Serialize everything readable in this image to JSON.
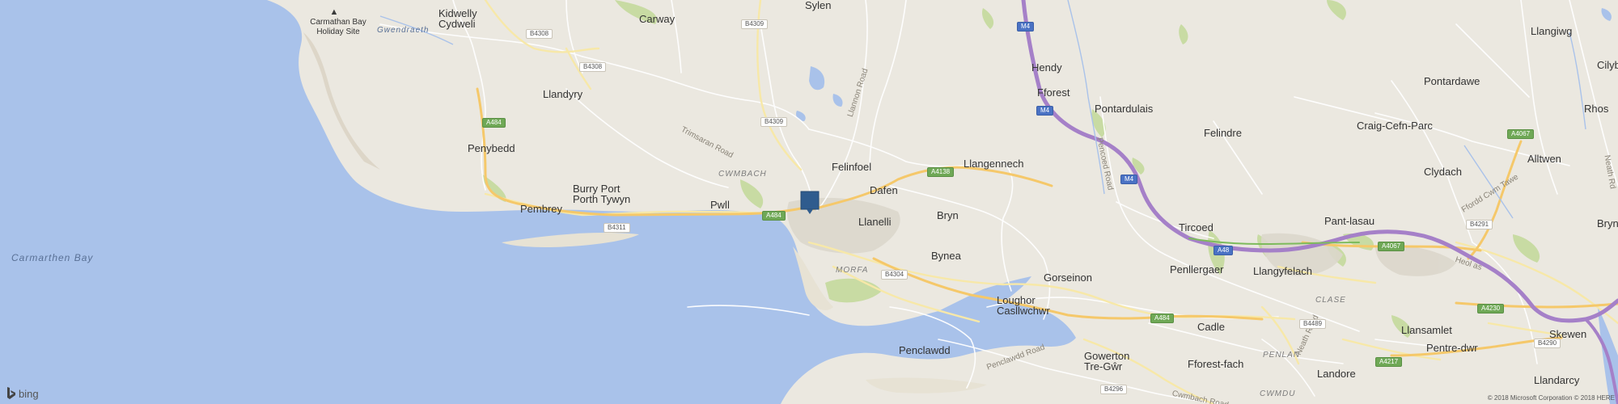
{
  "map": {
    "provider": "bing",
    "copyright": "© 2018 Microsoft Corporation © 2018 HERE",
    "water_labels": [
      "Carmarthen Bay",
      "Gwendraeth"
    ],
    "places": [
      "Carmathan Bay Holiday Site",
      "Kidwelly Cydweli",
      "Carway",
      "Sylen",
      "Llandyry",
      "Penybedd",
      "Burry Port Porth Tywyn",
      "Pembrey",
      "Pwll",
      "Felinfoel",
      "Dafen",
      "Llanelli",
      "Llangennech",
      "Hendy",
      "Fforest",
      "Pontardulais",
      "Bryn",
      "Bynea",
      "Gorseinon",
      "Loughor Casllwchwr",
      "Penclawdd",
      "Gowerton Tre-Gŵr",
      "Tircoed",
      "Penllergaer",
      "Felindre",
      "Cadle",
      "Fforest-fach",
      "Craig-Cefn-Parc",
      "Pontardawe",
      "Llangiwg",
      "Cilybe",
      "Rhos",
      "Alltwen",
      "Clydach",
      "Pant-lasau",
      "Llangyfelach",
      "Llansamlet",
      "Skewen",
      "Bryn-",
      "Pentre-dwr",
      "Llandarcy",
      "Landore"
    ],
    "districts": [
      "CWMBACH",
      "MORFA",
      "CLASE",
      "PENLAN",
      "CWMDU"
    ],
    "roads": [
      "Trimsaran Road",
      "Llannon Road",
      "Pencoed Road",
      "Penclawdd Road",
      "Cwmbach Road",
      "Neath Road",
      "Ffordd Cwm Tawe",
      "Heol as",
      "Neath Rd"
    ],
    "shields": [
      "B4308",
      "B4308",
      "B4309",
      "B4309",
      "A484",
      "B4311",
      "A484",
      "A4138",
      "B4304",
      "M4",
      "M4",
      "M4",
      "A48",
      "A484",
      "B4489",
      "B4296",
      "A4067",
      "A4067",
      "B4291",
      "A4230",
      "A4217",
      "B4290"
    ]
  }
}
